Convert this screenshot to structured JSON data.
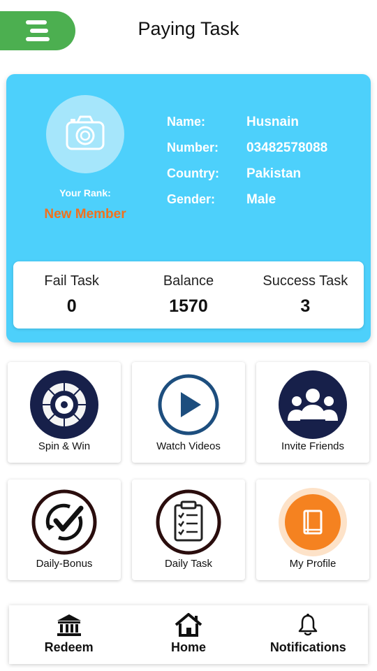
{
  "header": {
    "title": "Paying Task",
    "menu_icon": "menu-icon"
  },
  "profile": {
    "avatar_icon": "camera-icon",
    "rank_label": "Your Rank:",
    "rank_value": "New Member",
    "fields": [
      {
        "label": "Name:",
        "value": "Husnain"
      },
      {
        "label": "Number:",
        "value": "03482578088"
      },
      {
        "label": "Country:",
        "value": "Pakistan"
      },
      {
        "label": "Gender:",
        "value": "Male"
      }
    ]
  },
  "stats": {
    "fail": {
      "label": "Fail Task",
      "value": "0"
    },
    "balance": {
      "label": "Balance",
      "value": "1570"
    },
    "success": {
      "label": "Success Task",
      "value": "3"
    }
  },
  "tiles": [
    {
      "label": "Spin & Win",
      "icon": "spin-wheel-icon"
    },
    {
      "label": "Watch Videos",
      "icon": "play-icon"
    },
    {
      "label": "Invite Friends",
      "icon": "group-icon"
    },
    {
      "label": "Daily-Bonus",
      "icon": "refresh-check-icon"
    },
    {
      "label": "Daily Task",
      "icon": "clipboard-icon"
    },
    {
      "label": "My Profile",
      "icon": "book-icon"
    }
  ],
  "nav": [
    {
      "label": "Redeem",
      "icon": "bank-icon"
    },
    {
      "label": "Home",
      "icon": "home-icon"
    },
    {
      "label": "Notifications",
      "icon": "bell-icon"
    }
  ],
  "colors": {
    "accent_green": "#4caf50",
    "card_blue": "#4dd0fb",
    "rank_orange": "#f2711c",
    "navy": "#17204a",
    "profile_orange": "#f58220"
  }
}
